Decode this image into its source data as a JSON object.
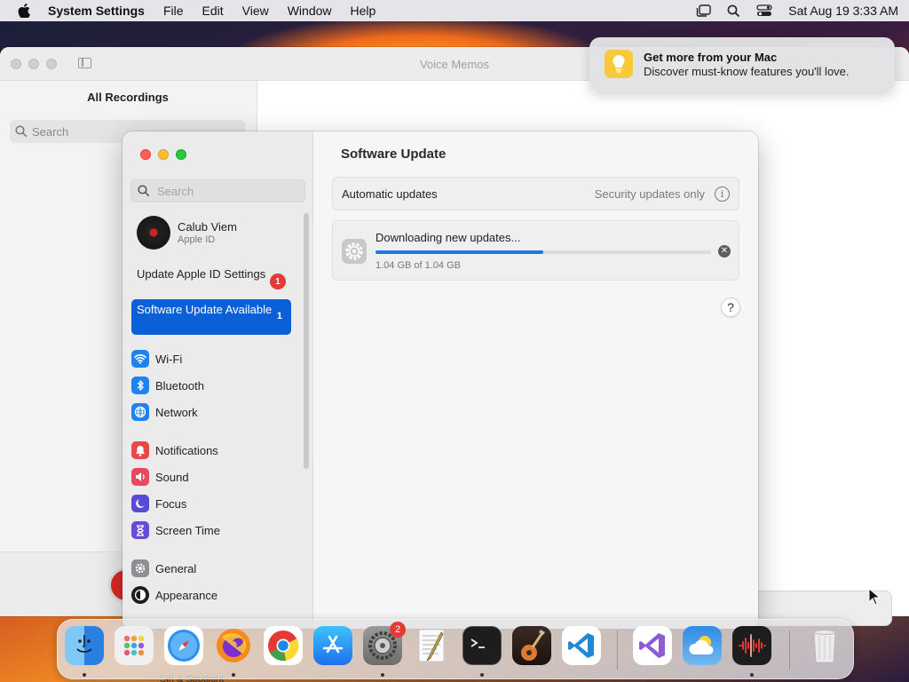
{
  "menubar": {
    "app_name": "System Settings",
    "items": [
      "File",
      "Edit",
      "View",
      "Window",
      "Help"
    ],
    "datetime": "Sat Aug 19  3:33 AM"
  },
  "voice_memos": {
    "title": "Voice Memos",
    "heading": "All Recordings",
    "search_placeholder": "Search"
  },
  "notification": {
    "title": "Get more from your Mac",
    "body": "Discover must-know features you'll love."
  },
  "settings": {
    "search_placeholder": "Search",
    "account": {
      "name": "Calub Viem",
      "subtitle": "Apple ID"
    },
    "update_apple_id": {
      "label": "Update Apple ID Settings",
      "badge": "1"
    },
    "selected": {
      "label": "Software Update Available",
      "badge": "1"
    },
    "sidebar_items": [
      {
        "label": "Wi-Fi",
        "color": "#1e82f0"
      },
      {
        "label": "Bluetooth",
        "color": "#1e82f0"
      },
      {
        "label": "Network",
        "color": "#1e82f0"
      },
      {
        "label": "Notifications",
        "color": "#e94848"
      },
      {
        "label": "Sound",
        "color": "#e94860"
      },
      {
        "label": "Focus",
        "color": "#5a4bd6"
      },
      {
        "label": "Screen Time",
        "color": "#6a4bd6"
      },
      {
        "label": "General",
        "color": "#8e8e93"
      },
      {
        "label": "Appearance",
        "color": "#1c1c1e"
      }
    ],
    "partial_item": "Siri & Spotlight",
    "main": {
      "heading": "Software Update",
      "auto_updates_label": "Automatic updates",
      "auto_updates_value": "Security updates only",
      "download_title": "Downloading new updates...",
      "download_size": "1.04 GB of 1.04 GB",
      "progress": 0.5,
      "help": "?"
    }
  },
  "dock": {
    "settings_badge": "2",
    "apps": [
      "Finder",
      "Launchpad",
      "Safari",
      "Firefox",
      "Chrome",
      "App Store",
      "System Settings",
      "TextEdit",
      "Terminal",
      "GarageBand",
      "Visual Studio Code",
      "Visual Studio",
      "Weather",
      "Voice Memos",
      "Trash"
    ]
  }
}
